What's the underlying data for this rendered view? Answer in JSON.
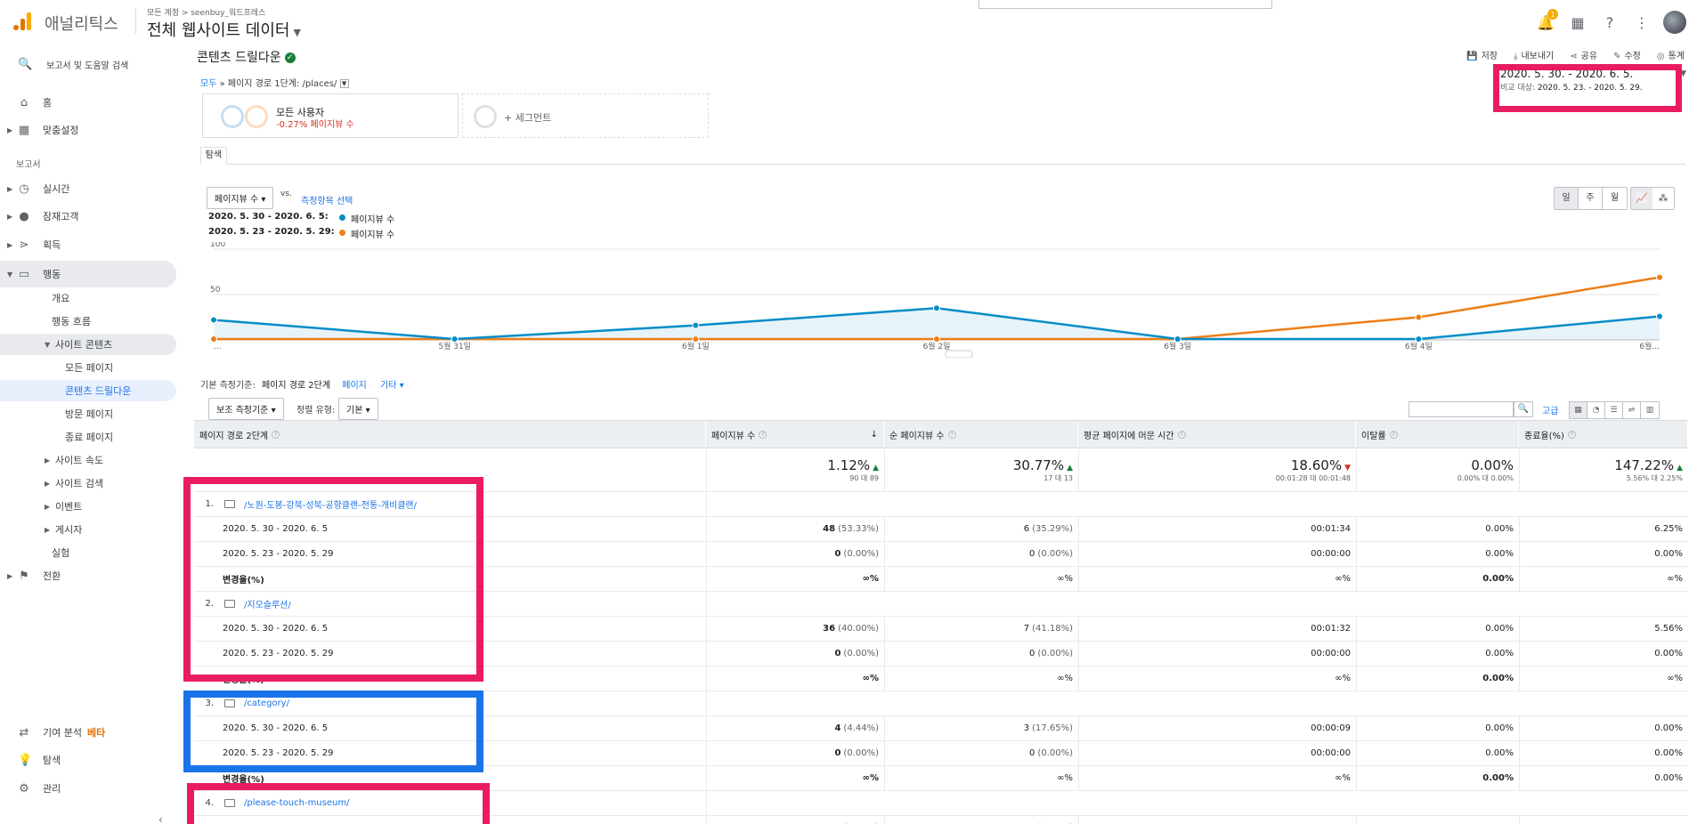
{
  "header": {
    "app_name": "애널리틱스",
    "crumb": "모든 계정 > seenbuy_워드프레스",
    "view_name": "전체 웹사이트 데이터",
    "notification_count": "1"
  },
  "sidebar": {
    "search": "보고서 및 도움말 검색",
    "home": "홈",
    "custom": "맞춤설정",
    "section_reports": "보고서",
    "realtime": "실시간",
    "audience": "잠재고객",
    "acquisition": "획득",
    "behavior": "행동",
    "behavior_items": [
      "개요",
      "행동 흐름",
      "사이트 콘텐츠"
    ],
    "site_content_items": [
      "모든 페이지",
      "콘텐츠 드릴다운",
      "방문 페이지",
      "종료 페이지"
    ],
    "behavior_more": [
      "사이트 속도",
      "사이트 검색",
      "이벤트",
      "게시자",
      "실험"
    ],
    "conversion": "전환",
    "attribution": "기여 분석",
    "beta": "베타",
    "discover": "탐색",
    "admin": "관리"
  },
  "report": {
    "title": "콘텐츠 드릴다운",
    "actions": [
      "저장",
      "내보내기",
      "공유",
      "수정",
      "통계"
    ],
    "path_all": "모두",
    "path_text": "» 페이지 경로 1단계: /places/",
    "segment_name": "모든 사용자",
    "segment_change": "-0.27% 페이지뷰 수",
    "add_segment": "+ 세그먼트",
    "date_main": "2020. 5. 30. - 2020. 6. 5.",
    "date_compare_label": "비교 대상:",
    "date_compare": "2020. 5. 23. - 2020. 5. 29.",
    "tab": "탐색",
    "metric": "페이지뷰 수",
    "vs": "vs.",
    "pick_metric": "측정항목 선택",
    "granularity": [
      "일",
      "주",
      "월"
    ],
    "legend": [
      {
        "range": "2020. 5. 30 - 2020. 6. 5:",
        "name": "페이지뷰 수",
        "color": "#058dc7"
      },
      {
        "range": "2020. 5. 23 - 2020. 5. 29:",
        "name": "페이지뷰 수",
        "color": "#ed7e17"
      }
    ]
  },
  "chart_data": {
    "type": "line",
    "x": [
      "...",
      "5월 31일",
      "6월 1일",
      "6월 2일",
      "6월 3일",
      "6월 4일",
      "6월..."
    ],
    "series": [
      {
        "name": "페이지뷰 수",
        "values": [
          22,
          1,
          16,
          35,
          1,
          1,
          26
        ],
        "color": "#058dc7"
      },
      {
        "name": "페이지뷰 수",
        "values": [
          1,
          1,
          1,
          1,
          1,
          25,
          69
        ],
        "color": "#ed7e17"
      }
    ],
    "ylim": [
      0,
      100
    ],
    "yticks": [
      50,
      100
    ],
    "grid": true
  },
  "table_controls": {
    "primary_label": "기본 측정기준:",
    "primary_active": "페이지 경로 2단계",
    "primary_links": [
      "페이지",
      "기타"
    ],
    "secondary": "보조 측정기준",
    "sort_label": "정렬 유형:",
    "sort_value": "기본",
    "advanced": "고급"
  },
  "table": {
    "headers": [
      "페이지 경로 2단계",
      "페이지뷰 수",
      "순 페이지뷰 수",
      "평균 페이지에 머문 시간",
      "이탈률",
      "종료율(%)"
    ],
    "totals": [
      {
        "big": "1.12%",
        "small": "90 대 89",
        "dir": "up"
      },
      {
        "big": "30.77%",
        "small": "17 대 13",
        "dir": "up"
      },
      {
        "big": "18.60%",
        "small": "00:01:28 대 00:01:48",
        "dir": "down"
      },
      {
        "big": "0.00%",
        "small": "0.00% 대 0.00%",
        "dir": ""
      },
      {
        "big": "147.22%",
        "small": "5.56% 대 2.25%",
        "dir": "up"
      }
    ],
    "groups": [
      {
        "rank": "1.",
        "path": "/노원-도봉-강북-성북-공항클랜-전통-개비클랜/",
        "rows": [
          {
            "label": "2020. 5. 30 - 2020. 6. 5",
            "pv": "48",
            "pvp": "(53.33%)",
            "upv": "6",
            "upvp": "(35.29%)",
            "time": "00:01:34",
            "bounce": "0.00%",
            "exit": "6.25%"
          },
          {
            "label": "2020. 5. 23 - 2020. 5. 29",
            "pv": "0",
            "pvp": "(0.00%)",
            "upv": "0",
            "upvp": "(0.00%)",
            "time": "00:00:00",
            "bounce": "0.00%",
            "exit": "0.00%"
          },
          {
            "label": "변경율(%)",
            "pv": "∞%",
            "pvp": "",
            "upv": "∞%",
            "upvp": "",
            "time": "∞%",
            "bounce": "0.00%",
            "exit": "∞%"
          }
        ]
      },
      {
        "rank": "2.",
        "path": "/지오슬루션/",
        "rows": [
          {
            "label": "2020. 5. 30 - 2020. 6. 5",
            "pv": "36",
            "pvp": "(40.00%)",
            "upv": "7",
            "upvp": "(41.18%)",
            "time": "00:01:32",
            "bounce": "0.00%",
            "exit": "5.56%"
          },
          {
            "label": "2020. 5. 23 - 2020. 5. 29",
            "pv": "0",
            "pvp": "(0.00%)",
            "upv": "0",
            "upvp": "(0.00%)",
            "time": "00:00:00",
            "bounce": "0.00%",
            "exit": "0.00%"
          },
          {
            "label": "변경율(%)",
            "pv": "∞%",
            "pvp": "",
            "upv": "∞%",
            "upvp": "",
            "time": "∞%",
            "bounce": "0.00%",
            "exit": "∞%"
          }
        ]
      },
      {
        "rank": "3.",
        "path": "/category/",
        "rows": [
          {
            "label": "2020. 5. 30 - 2020. 6. 5",
            "pv": "4",
            "pvp": "(4.44%)",
            "upv": "3",
            "upvp": "(17.65%)",
            "time": "00:00:09",
            "bounce": "0.00%",
            "exit": "0.00%"
          },
          {
            "label": "2020. 5. 23 - 2020. 5. 29",
            "pv": "0",
            "pvp": "(0.00%)",
            "upv": "0",
            "upvp": "(0.00%)",
            "time": "00:00:00",
            "bounce": "0.00%",
            "exit": "0.00%"
          },
          {
            "label": "변경율(%)",
            "pv": "∞%",
            "pvp": "",
            "upv": "∞%",
            "upvp": "",
            "time": "∞%",
            "bounce": "0.00%",
            "exit": "0.00%"
          }
        ]
      },
      {
        "rank": "4.",
        "path": "/please-touch-museum/",
        "rows": [
          {
            "label": "2020. 5. 30 - 2020. 6. 5",
            "pv": "2",
            "pvp": "(2.22%)",
            "upv": "1",
            "upvp": "(5.88%)",
            "time": "00:00:05",
            "bounce": "0.00%",
            "exit": "0.00%"
          }
        ]
      }
    ]
  }
}
